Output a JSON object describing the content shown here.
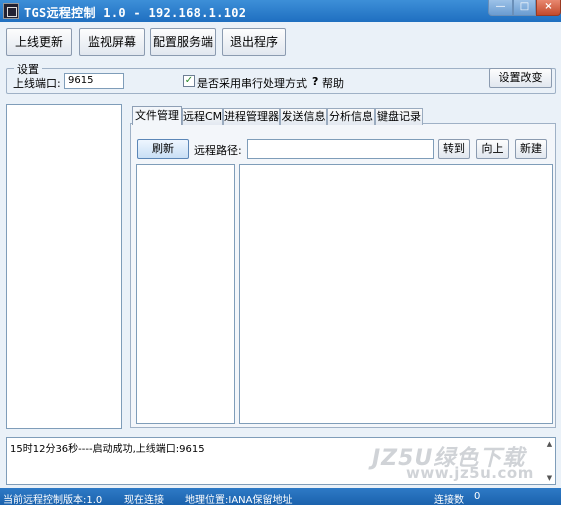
{
  "window": {
    "title": "TGS远程控制 1.0 - 192.168.1.102",
    "minimize": "—",
    "maximize": "□",
    "close": "×"
  },
  "toolbar": {
    "online_update": "上线更新",
    "monitor_screen": "监视屏幕",
    "config_server": "配置服务端",
    "exit_program": "退出程序"
  },
  "settings": {
    "group_title": "设置",
    "port_label": "上线端口:",
    "port_value": "9615",
    "serial_checked": true,
    "serial_label": "是否采用串行处理方式",
    "help_label": "帮助",
    "apply_button": "设置改变"
  },
  "tabs": [
    {
      "label": "文件管理",
      "active": true
    },
    {
      "label": "远程CMD",
      "active": false
    },
    {
      "label": "进程管理器",
      "active": false
    },
    {
      "label": "发送信息",
      "active": false
    },
    {
      "label": "分析信息",
      "active": false
    },
    {
      "label": "键盘记录",
      "active": false
    }
  ],
  "file_manager": {
    "refresh_button": "刷新",
    "remote_path_label": "远程路径:",
    "remote_path_value": "",
    "goto_button": "转到",
    "up_button": "向上",
    "new_button": "新建"
  },
  "log": {
    "message": "15时12分36秒----启动成功,上线端口:9615"
  },
  "statusbar": {
    "version": "当前远程控制版本:1.0",
    "connection": "现在连接",
    "location": "地理位置:IANA保留地址",
    "count_label": "连接数",
    "count_value": "0"
  },
  "watermark": {
    "text": "JZ5U绿色下载",
    "url": "www.jz5u.com"
  }
}
